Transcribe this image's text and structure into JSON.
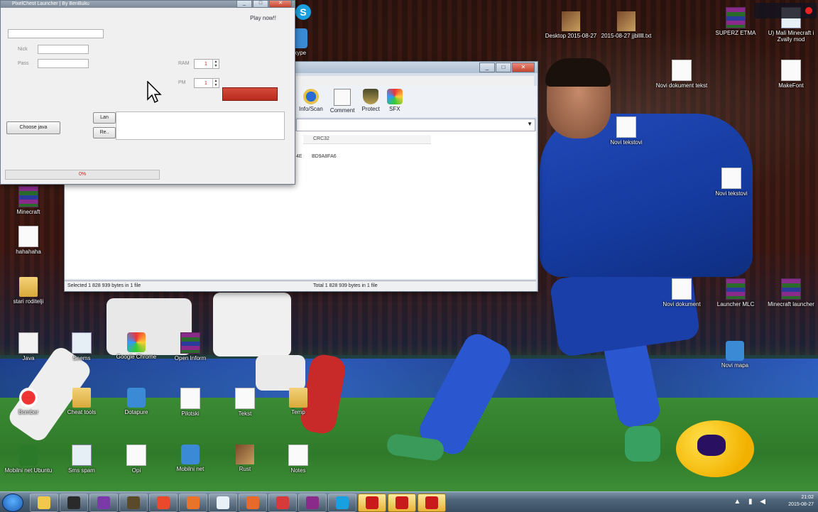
{
  "launcher": {
    "title": "PixelChest Launcher | By BenBuku",
    "link": "Play now!!",
    "name_label": "Nick",
    "pass_label": "Pass",
    "ram_label": "RAM",
    "perm_label": "PM",
    "spin1_value": "1",
    "spin2_value": "1",
    "choose_button": "Choose java",
    "small_btn1": "Lan",
    "small_btn2": "Re..",
    "progress_text": "0%"
  },
  "winrar": {
    "toolbar": [
      {
        "label": "Info/Scan",
        "icon": "info-icon"
      },
      {
        "label": "Comment",
        "icon": "comment-icon"
      },
      {
        "label": "Protect",
        "icon": "protect-icon"
      },
      {
        "label": "SFX",
        "icon": "sfx-icon"
      }
    ],
    "column_header": "CRC32",
    "row_crc": "BD9A8FA6",
    "row_prefix": "4E",
    "status_left": "Selected 1 828 939 bytes in 1 file",
    "status_right": "Total 1 828 939 bytes in 1 file"
  },
  "desktop_icons": [
    {
      "label": "Minecraft",
      "kind": "g-rar"
    },
    {
      "label": "hahahaha",
      "kind": "g-doc"
    },
    {
      "label": "stari roditelji",
      "kind": "g-folder"
    },
    {
      "label": "Java",
      "kind": "g-java"
    },
    {
      "label": "Bomber",
      "kind": "g-ball"
    },
    {
      "label": "Mobilni net Ubuntu",
      "kind": "g-wifi"
    },
    {
      "label": "Skype",
      "kind": "g-blue"
    },
    {
      "label": "Desktop 2015-08-27",
      "kind": "g-img"
    },
    {
      "label": "2015-08-27 jjblllll.txt",
      "kind": "g-img"
    },
    {
      "label": "SUPERZ ETMA",
      "kind": "g-rar"
    },
    {
      "label": "U) Mali Minecraft i Zvally mod",
      "kind": "g-exe"
    },
    {
      "label": "Novi dokument tekst",
      "kind": "g-doc"
    },
    {
      "label": "MakeFont",
      "kind": "g-doc"
    },
    {
      "label": "Novi tekstovi",
      "kind": "g-doc"
    },
    {
      "label": "Launcher MLC",
      "kind": "g-rar"
    },
    {
      "label": "Minecraft launcher",
      "kind": "g-rar"
    },
    {
      "label": "Novi dokument",
      "kind": "g-doc"
    },
    {
      "label": "Novi tekstovi",
      "kind": "g-doc"
    },
    {
      "label": "Novi mapa",
      "kind": "g-blue"
    },
    {
      "label": "Seems",
      "kind": "g-exe"
    },
    {
      "label": "Google Chrome",
      "kind": "g-colors"
    },
    {
      "label": "Open Inform",
      "kind": "g-rar"
    },
    {
      "label": "Cheat tools",
      "kind": "g-folder"
    },
    {
      "label": "Dotapure",
      "kind": "g-blue"
    },
    {
      "label": "Pilotski",
      "kind": "g-doc"
    },
    {
      "label": "Tekst",
      "kind": "g-doc"
    },
    {
      "label": "Sms spam",
      "kind": "g-exe"
    },
    {
      "label": "Rust",
      "kind": "g-img"
    },
    {
      "label": "Opi",
      "kind": "g-doc"
    },
    {
      "label": "Mobilni net",
      "kind": "g-blue"
    },
    {
      "label": "Temp",
      "kind": "g-folder"
    },
    {
      "label": "Notes",
      "kind": "g-doc"
    }
  ],
  "taskbar": {
    "time": "21:02",
    "date": "2015-08-27",
    "apps": [
      "explorer",
      "badge-15",
      "purple-app",
      "minecraft",
      "chrome",
      "firefox",
      "vlc",
      "orange-app",
      "bomber",
      "winrar",
      "skype",
      "block-red-1",
      "block-red-2",
      "block-red-3"
    ]
  }
}
